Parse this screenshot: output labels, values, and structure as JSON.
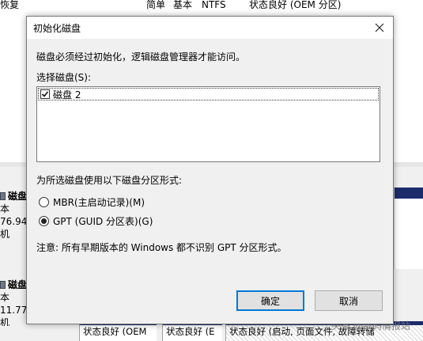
{
  "background": {
    "top_row": {
      "col1": "恢复",
      "col2": "简单",
      "col3": "基本",
      "col4": "NTFS",
      "col5": "状态良好 (OEM 分区)"
    },
    "disks": [
      {
        "name": "磁盘",
        "line2": "本",
        "line3": "76.94",
        "line4": "机"
      },
      {
        "name": "磁盘",
        "line2": "本",
        "line3": "11.77",
        "line4": "机"
      }
    ],
    "bottom_cells": [
      "状态良好 (OEM",
      "状态良好 (E",
      "状态良好 (启动, 页面文件, 故障转储"
    ],
    "watermark": "头条 @数码情报站"
  },
  "dialog": {
    "title": "初始化磁盘",
    "description": "磁盘必须经过初始化，逻辑磁盘管理器才能访问。",
    "select_label": "选择磁盘(S):",
    "disks": [
      {
        "label": "磁盘 2",
        "checked": true
      }
    ],
    "style_label": "为所选磁盘使用以下磁盘分区形式:",
    "options": [
      {
        "label": "MBR(主启动记录)(M)",
        "selected": false
      },
      {
        "label": "GPT (GUID 分区表)(G)",
        "selected": true
      }
    ],
    "note": "注意: 所有早期版本的 Windows 都不识别 GPT 分区形式。",
    "ok_label": "确定",
    "cancel_label": "取消"
  }
}
